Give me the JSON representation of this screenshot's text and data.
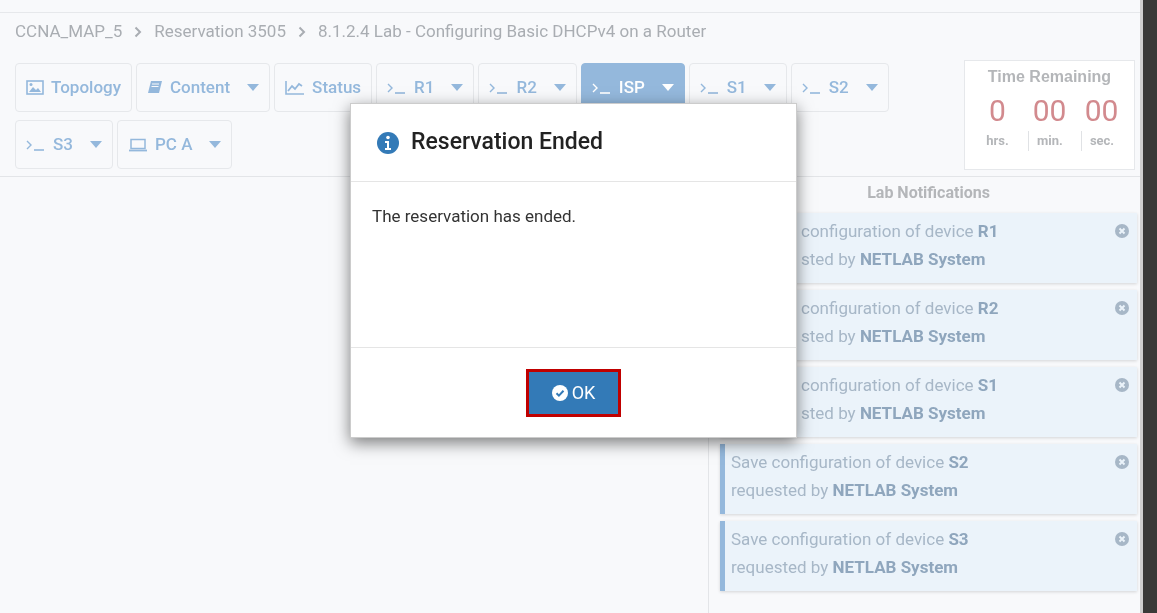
{
  "breadcrumb": [
    "CCNA_MAP_5",
    "Reservation 3505",
    "8.1.2.4 Lab - Configuring Basic DHCPv4 on a Router"
  ],
  "tabs": [
    {
      "label": "Topology",
      "kind": "image",
      "menu": false,
      "selected": false
    },
    {
      "label": "Content",
      "kind": "book",
      "menu": true,
      "selected": false
    },
    {
      "label": "Status",
      "kind": "chart",
      "menu": false,
      "selected": false
    },
    {
      "label": "R1",
      "kind": "terminal",
      "menu": true,
      "selected": false
    },
    {
      "label": "R2",
      "kind": "terminal",
      "menu": true,
      "selected": false
    },
    {
      "label": "ISP",
      "kind": "terminal",
      "menu": true,
      "selected": true
    },
    {
      "label": "S1",
      "kind": "terminal",
      "menu": true,
      "selected": false
    },
    {
      "label": "S2",
      "kind": "terminal",
      "menu": true,
      "selected": false
    },
    {
      "label": "S3",
      "kind": "terminal",
      "menu": true,
      "selected": false
    },
    {
      "label": "PC A",
      "kind": "laptop",
      "menu": true,
      "selected": false
    }
  ],
  "timer": {
    "title": "Time Remaining",
    "parts": [
      {
        "value": "0",
        "unit": "hrs."
      },
      {
        "value": "00",
        "unit": "min."
      },
      {
        "value": "00",
        "unit": "sec."
      }
    ]
  },
  "notifications": {
    "title": "Lab Notifications",
    "items": [
      {
        "lines": [
          "configuration of device **R1**",
          "sted by **NETLAB System**"
        ],
        "covered": true
      },
      {
        "lines": [
          "configuration of device **R2**",
          "sted by **NETLAB System**"
        ],
        "covered": true
      },
      {
        "lines": [
          "configuration of device **S1**",
          "sted by **NETLAB System**"
        ],
        "covered": true
      },
      {
        "lines": [
          "Save configuration of device **S2**",
          "requested by **NETLAB System**"
        ],
        "covered": false
      },
      {
        "lines": [
          "Save configuration of device **S3**",
          "requested by **NETLAB System**"
        ],
        "covered": false
      }
    ]
  },
  "dialog": {
    "title": "Reservation Ended",
    "message": "The reservation has ended.",
    "button": "OK"
  }
}
